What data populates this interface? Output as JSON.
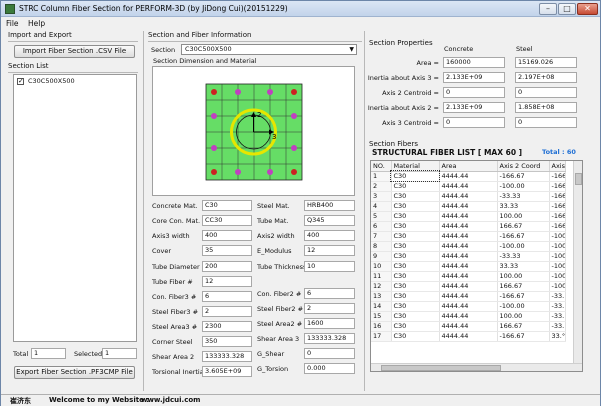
{
  "window": {
    "title": "STRC Column Fiber Section for PERFORM-3D (by JiDong Cui)(20151229)"
  },
  "menu": [
    "File",
    "Help"
  ],
  "import_export": {
    "group_label": "Import and Export",
    "import_button": "Import Fiber Section .CSV File",
    "export_button": "Export Fiber Section .PF3CMP File"
  },
  "section_list": {
    "label": "Section List",
    "items": [
      {
        "name": "C30C500X500",
        "checked": true
      }
    ],
    "total_label": "Total",
    "total_value": "1",
    "selected_label": "Selected",
    "selected_value": "1"
  },
  "fiber_info": {
    "group_label": "Section and Fiber Information",
    "section_label": "Section",
    "section_value": "C30C500X500",
    "drawing_label": "Section Dimension and Material",
    "axis_labels": {
      "axis2": "2",
      "axis3": "3"
    },
    "colors": {
      "concrete": "#66dd66",
      "steel_bar": "#c040c0",
      "tube": "#e6e600",
      "stirrup": "#cc2222"
    }
  },
  "params_left": [
    {
      "label": "Concrete Mat.",
      "value": "C30"
    },
    {
      "label": "Core Con. Mat.",
      "value": "CC30"
    },
    {
      "label": "Axis3 width",
      "value": "400"
    },
    {
      "label": "Cover",
      "value": "35"
    },
    {
      "label": "Tube Diameter",
      "value": "200"
    },
    {
      "label": "Tube Fiber #",
      "value": "12"
    },
    {
      "label": "Con. Fiber3 #",
      "value": "6"
    },
    {
      "label": "Steel Fiber3 #",
      "value": "2"
    },
    {
      "label": "Steel Area3 #",
      "value": "2300"
    },
    {
      "label": "Corner Steel",
      "value": "350"
    },
    {
      "label": "Shear Area 2",
      "value": "133333.328"
    },
    {
      "label": "Torsional Inertia",
      "value": "3.605E+09"
    }
  ],
  "params_right": [
    {
      "label": "Steel Mat.",
      "value": "HRB400"
    },
    {
      "label": "Tube Mat.",
      "value": "Q345"
    },
    {
      "label": "Axis2 width",
      "value": "400"
    },
    {
      "label": "E_Modulus",
      "value": "12"
    },
    {
      "label": "Tube Thickness",
      "value": "10"
    },
    {
      "label": "Con. Fiber2 #",
      "value": "6"
    },
    {
      "label": "Steel Fiber2 #",
      "value": "2"
    },
    {
      "label": "Steel Area2 #",
      "value": "1600"
    },
    {
      "label": "Shear Area 3",
      "value": "133333.328"
    },
    {
      "label": "G_Shear",
      "value": "0"
    },
    {
      "label": "G_Torsion",
      "value": "0.000"
    }
  ],
  "section_properties": {
    "group_label": "Section Properties",
    "col_concrete": "Concrete",
    "col_steel": "Steel",
    "rows": [
      {
        "label": "Area =",
        "concrete": "160000",
        "steel": "15169.026"
      },
      {
        "label": "Inertia about Axis 3 =",
        "concrete": "2.133E+09",
        "steel": "2.197E+08"
      },
      {
        "label": "Axis 2 Centroid =",
        "concrete": "0",
        "steel": "0"
      },
      {
        "label": "Inertia about Axis 2 =",
        "concrete": "2.133E+09",
        "steel": "1.858E+08"
      },
      {
        "label": "Axis 3 Centroid =",
        "concrete": "0",
        "steel": "0"
      }
    ]
  },
  "section_fibers": {
    "group_label": "Section Fibers",
    "list_title": "STRUCTURAL FIBER LIST [ MAX 60 ]",
    "total_label": "Total : 60",
    "columns": [
      "NO.",
      "Material",
      "Area",
      "Axis 2 Coord",
      "Axis"
    ],
    "rows": [
      [
        "1",
        "C30",
        "4444.44",
        "-166.67",
        "-166"
      ],
      [
        "2",
        "C30",
        "4444.44",
        "-100.00",
        "-166"
      ],
      [
        "3",
        "C30",
        "4444.44",
        "-33.33",
        "-166"
      ],
      [
        "4",
        "C30",
        "4444.44",
        "33.33",
        "-166"
      ],
      [
        "5",
        "C30",
        "4444.44",
        "100.00",
        "-166"
      ],
      [
        "6",
        "C30",
        "4444.44",
        "166.67",
        "-166"
      ],
      [
        "7",
        "C30",
        "4444.44",
        "-166.67",
        "-100"
      ],
      [
        "8",
        "C30",
        "4444.44",
        "-100.00",
        "-100"
      ],
      [
        "9",
        "C30",
        "4444.44",
        "-33.33",
        "-100"
      ],
      [
        "10",
        "C30",
        "4444.44",
        "33.33",
        "-100"
      ],
      [
        "11",
        "C30",
        "4444.44",
        "100.00",
        "-100"
      ],
      [
        "12",
        "C30",
        "4444.44",
        "166.67",
        "-100"
      ],
      [
        "13",
        "C30",
        "4444.44",
        "-166.67",
        "-33."
      ],
      [
        "14",
        "C30",
        "4444.44",
        "-100.00",
        "-33."
      ],
      [
        "15",
        "C30",
        "4444.44",
        "100.00",
        "-33."
      ],
      [
        "16",
        "C30",
        "4444.44",
        "166.67",
        "-33."
      ],
      [
        "17",
        "C30",
        "4444.44",
        "-166.67",
        "33.°"
      ]
    ]
  },
  "status": {
    "author": "崔济东",
    "welcome": "Welcome to my Website :",
    "website": "www.jdcui.com"
  }
}
